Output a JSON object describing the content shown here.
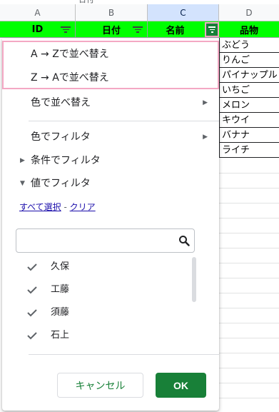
{
  "sheet": {
    "prev_row_text": "日付",
    "columns": [
      "A",
      "B",
      "C",
      "D"
    ],
    "headers": [
      "ID",
      "日付",
      "名前",
      "品物"
    ],
    "header_color": "#00ff00",
    "d_values": [
      "ぶどう",
      "りんご",
      "パイナップル",
      "いちご",
      "メロン",
      "キウイ",
      "バナナ",
      "ライチ"
    ]
  },
  "menu": {
    "sort_az": "A → Zで並べ替え",
    "sort_za": "Z → Aで並べ替え",
    "sort_color": "色で並べ替え",
    "filter_color": "色でフィルタ",
    "filter_condition": "条件でフィルタ",
    "filter_values": "値でフィルタ",
    "select_all": "すべて選択",
    "link_separator": " - ",
    "clear": "クリア",
    "search_placeholder": "",
    "values": [
      "久保",
      "工藤",
      "須藤",
      "石上"
    ],
    "cancel": "キャンセル",
    "ok": "OK",
    "accent_color": "#188038",
    "highlight_color": "#f4a8c4"
  }
}
